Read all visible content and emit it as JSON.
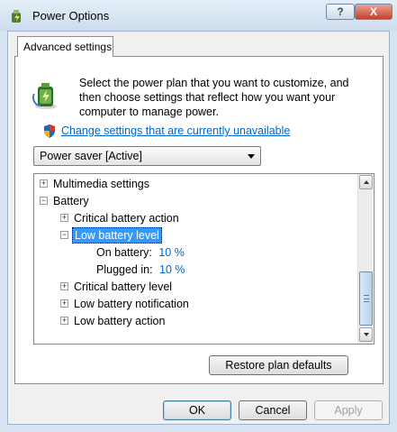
{
  "window": {
    "title": "Power Options",
    "help_symbol": "?",
    "close_symbol": "X"
  },
  "tab": {
    "label": "Advanced settings"
  },
  "description": "Select the power plan that you want to customize, and then choose settings that reflect how you want your computer to manage power.",
  "change_link": "Change settings that are currently unavailable",
  "plan_select": {
    "value": "Power saver [Active]"
  },
  "tree": {
    "multimedia": {
      "symbol": "+",
      "label": "Multimedia settings"
    },
    "battery": {
      "symbol": "−",
      "label": "Battery"
    },
    "critical_action": {
      "symbol": "+",
      "label": "Critical battery action"
    },
    "low_level": {
      "symbol": "−",
      "label": "Low battery level"
    },
    "on_battery": {
      "label": "On battery:",
      "value": "10 %"
    },
    "plugged_in": {
      "label": "Plugged in:",
      "value": "10 %"
    },
    "critical_level": {
      "symbol": "+",
      "label": "Critical battery level"
    },
    "low_notification": {
      "symbol": "+",
      "label": "Low battery notification"
    },
    "low_action": {
      "symbol": "+",
      "label": "Low battery action"
    }
  },
  "buttons": {
    "restore": "Restore plan defaults",
    "ok": "OK",
    "cancel": "Cancel",
    "apply": "Apply"
  },
  "colors": {
    "link": "#0066cc",
    "selection": "#3399ff",
    "window_frame": "#d7e4f2"
  }
}
